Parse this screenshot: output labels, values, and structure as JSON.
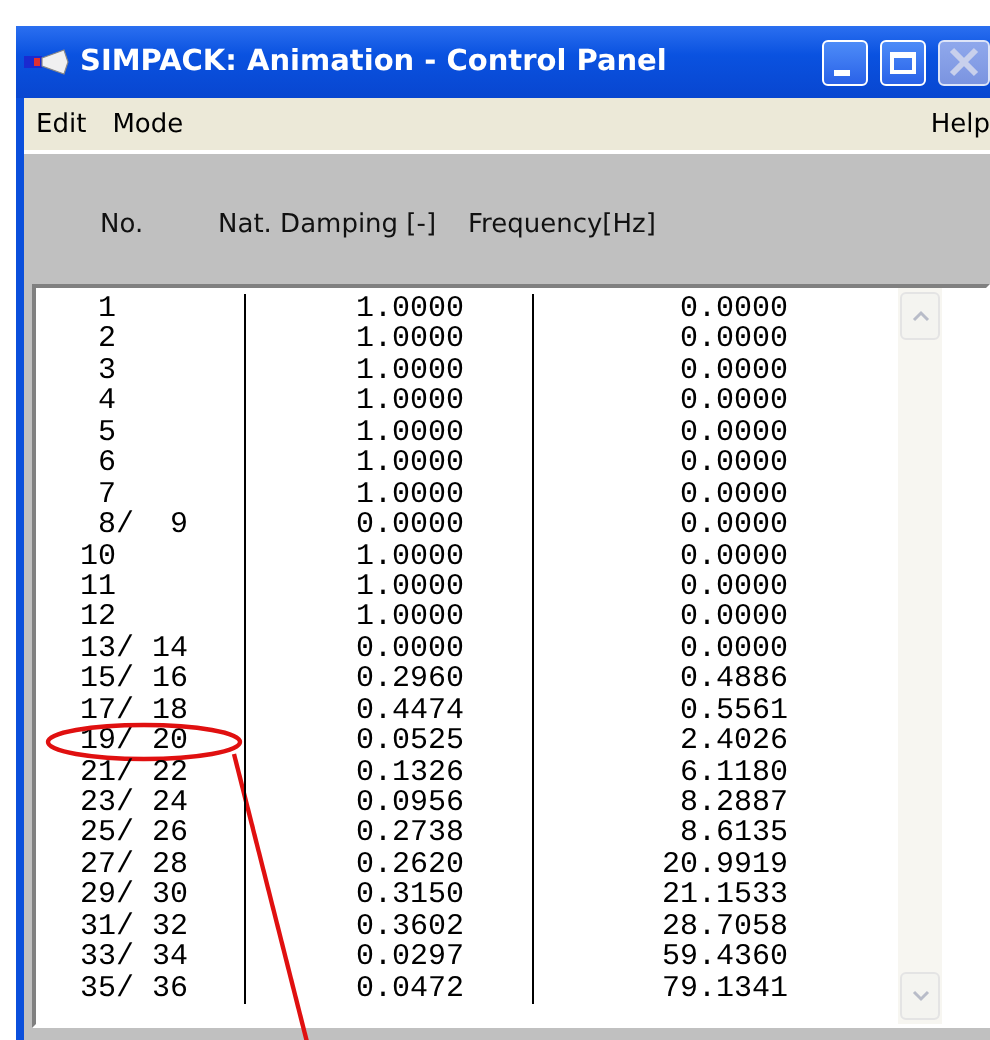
{
  "window": {
    "title": "SIMPACK: Animation - Control Panel"
  },
  "menu": {
    "left": [
      "Edit",
      "Mode"
    ],
    "right": [
      "Help"
    ]
  },
  "columns": [
    "No.",
    "Nat. Damping [-]",
    "Frequency[Hz]"
  ],
  "rows": [
    {
      "no": "1",
      "damping": "1.0000",
      "frequency": "0.0000",
      "annotated": false
    },
    {
      "no": "2",
      "damping": "1.0000",
      "frequency": "0.0000",
      "annotated": false
    },
    {
      "no": "3",
      "damping": "1.0000",
      "frequency": "0.0000",
      "annotated": false
    },
    {
      "no": "4",
      "damping": "1.0000",
      "frequency": "0.0000",
      "annotated": false
    },
    {
      "no": "5",
      "damping": "1.0000",
      "frequency": "0.0000",
      "annotated": false
    },
    {
      "no": "6",
      "damping": "1.0000",
      "frequency": "0.0000",
      "annotated": false
    },
    {
      "no": "7",
      "damping": "1.0000",
      "frequency": "0.0000",
      "annotated": false
    },
    {
      "no": "8/  9",
      "damping": "0.0000",
      "frequency": "0.0000",
      "annotated": false
    },
    {
      "no": "10",
      "damping": "1.0000",
      "frequency": "0.0000",
      "annotated": false
    },
    {
      "no": "11",
      "damping": "1.0000",
      "frequency": "0.0000",
      "annotated": false
    },
    {
      "no": "12",
      "damping": "1.0000",
      "frequency": "0.0000",
      "annotated": false
    },
    {
      "no": "13/ 14",
      "damping": "0.0000",
      "frequency": "0.0000",
      "annotated": false
    },
    {
      "no": "15/ 16",
      "damping": "0.2960",
      "frequency": "0.4886",
      "annotated": false
    },
    {
      "no": "17/ 18",
      "damping": "0.4474",
      "frequency": "0.5561",
      "annotated": false
    },
    {
      "no": "19/ 20",
      "damping": "0.0525",
      "frequency": "2.4026",
      "annotated": true
    },
    {
      "no": "21/ 22",
      "damping": "0.1326",
      "frequency": "6.1180",
      "annotated": false
    },
    {
      "no": "23/ 24",
      "damping": "0.0956",
      "frequency": "8.2887",
      "annotated": false
    },
    {
      "no": "25/ 26",
      "damping": "0.2738",
      "frequency": "8.6135",
      "annotated": false
    },
    {
      "no": "27/ 28",
      "damping": "0.2620",
      "frequency": "20.9919",
      "annotated": false
    },
    {
      "no": "29/ 30",
      "damping": "0.3150",
      "frequency": "21.1533",
      "annotated": false
    },
    {
      "no": "31/ 32",
      "damping": "0.3602",
      "frequency": "28.7058",
      "annotated": false
    },
    {
      "no": "33/ 34",
      "damping": "0.0297",
      "frequency": "59.4360",
      "annotated": false
    },
    {
      "no": "35/ 36",
      "damping": "0.0472",
      "frequency": "79.1341",
      "annotated": false
    }
  ]
}
